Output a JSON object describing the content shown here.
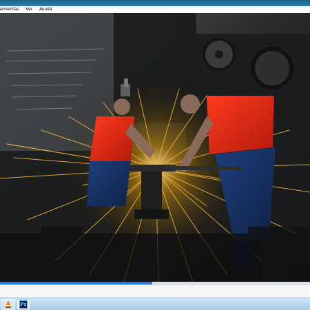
{
  "app": {
    "menu": [
      {
        "label": "ramientas"
      },
      {
        "label": "Ver"
      },
      {
        "label": "Ayuda"
      }
    ]
  },
  "viewer": {
    "image_name": "blacksmiths-sparks-photo"
  },
  "progress": {
    "value_fraction": 0.49,
    "color": "#2a7ae2"
  },
  "taskbar": {
    "buttons": [
      {
        "icon": "vlc-icon"
      },
      {
        "icon": "photoshop-icon",
        "label": "Ps"
      }
    ]
  }
}
